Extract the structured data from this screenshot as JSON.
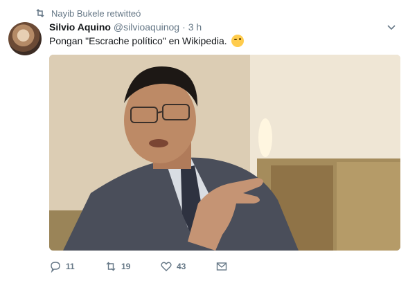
{
  "retweet_context": {
    "text": "Nayib Bukele retwitteó"
  },
  "author": {
    "fullname": "Silvio Aquino",
    "username": "@silvioaquinog",
    "separator": "·",
    "time": "3 h"
  },
  "tweet": {
    "text": "Pongan \"Escrache político\" en Wikipedia.",
    "emoji": "winking-face"
  },
  "actions": {
    "reply_count": "11",
    "retweet_count": "19",
    "like_count": "43"
  },
  "colors": {
    "secondary_text": "#657786",
    "primary_text": "#14171a"
  }
}
